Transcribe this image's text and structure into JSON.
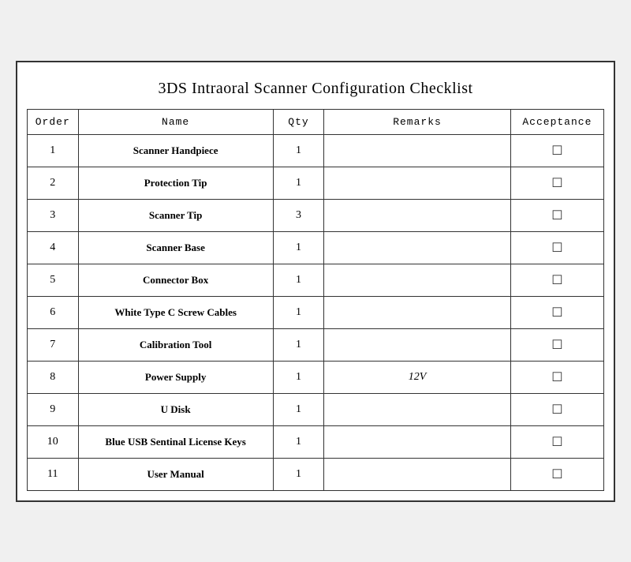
{
  "title": "3DS Intraoral Scanner Configuration Checklist",
  "columns": {
    "order": "Order",
    "name": "Name",
    "qty": "Qty",
    "remarks": "Remarks",
    "acceptance": "Acceptance"
  },
  "rows": [
    {
      "order": "1",
      "name": "Scanner Handpiece",
      "qty": "1",
      "remarks": "",
      "acceptance": "☐"
    },
    {
      "order": "2",
      "name": "Protection Tip",
      "qty": "1",
      "remarks": "",
      "acceptance": "☐"
    },
    {
      "order": "3",
      "name": "Scanner Tip",
      "qty": "3",
      "remarks": "",
      "acceptance": "☐"
    },
    {
      "order": "4",
      "name": "Scanner Base",
      "qty": "1",
      "remarks": "",
      "acceptance": "☐"
    },
    {
      "order": "5",
      "name": "Connector Box",
      "qty": "1",
      "remarks": "",
      "acceptance": "☐"
    },
    {
      "order": "6",
      "name": "White Type C Screw Cables",
      "qty": "1",
      "remarks": "",
      "acceptance": "☐"
    },
    {
      "order": "7",
      "name": "Calibration Tool",
      "qty": "1",
      "remarks": "",
      "acceptance": "☐"
    },
    {
      "order": "8",
      "name": "Power Supply",
      "qty": "1",
      "remarks": "12V",
      "acceptance": "☐"
    },
    {
      "order": "9",
      "name": "U Disk",
      "qty": "1",
      "remarks": "",
      "acceptance": "☐"
    },
    {
      "order": "10",
      "name": "Blue USB Sentinal License Keys",
      "qty": "1",
      "remarks": "",
      "acceptance": "☐"
    },
    {
      "order": "11",
      "name": "User Manual",
      "qty": "1",
      "remarks": "",
      "acceptance": "☐"
    }
  ]
}
